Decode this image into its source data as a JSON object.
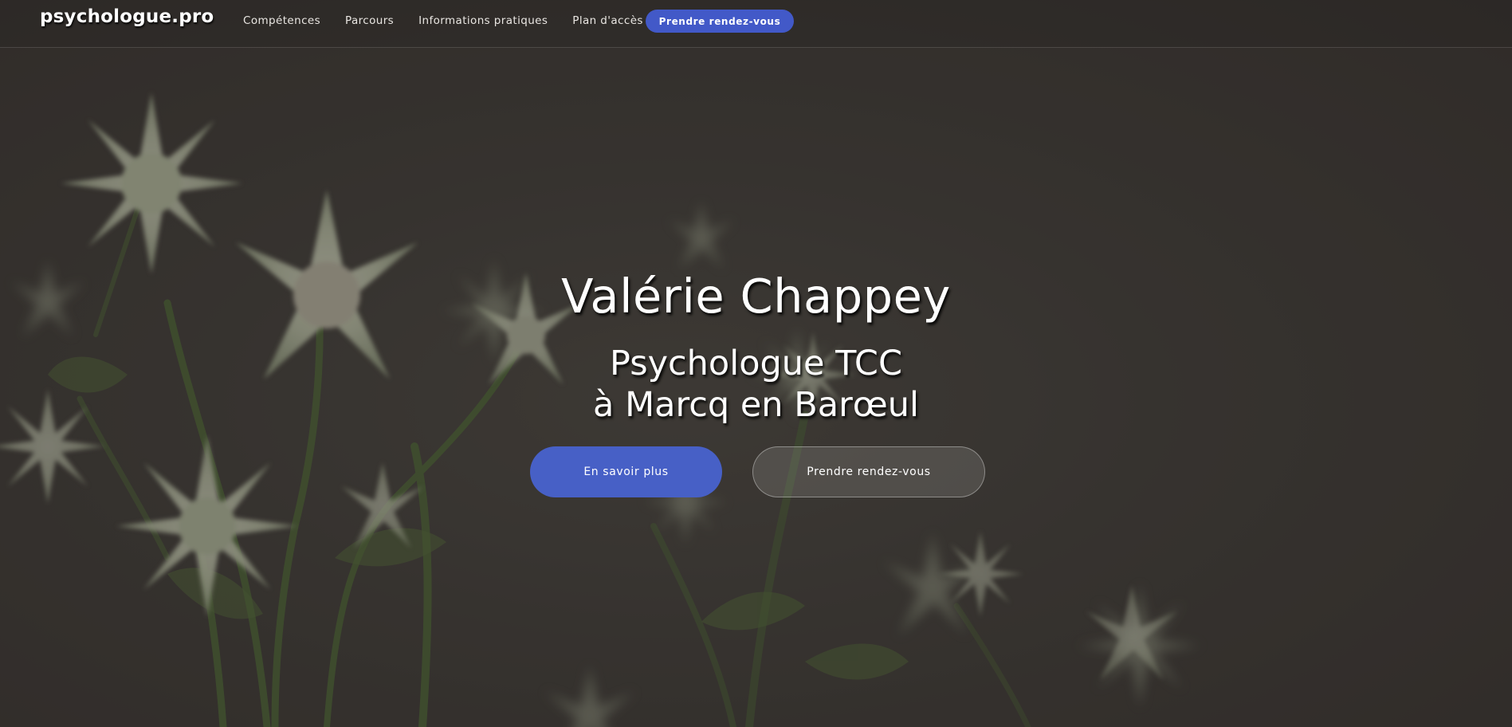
{
  "navbar": {
    "brand": "psychologue.pro",
    "links": [
      {
        "label": "Compétences"
      },
      {
        "label": "Parcours"
      },
      {
        "label": "Informations pratiques"
      },
      {
        "label": "Plan d'accès"
      }
    ],
    "cta_label": "Prendre rendez-vous"
  },
  "hero": {
    "title": "Valérie Chappey",
    "subtitle_line1": "Psychologue TCC",
    "subtitle_line2": "à Marcq en Barœul",
    "primary_button": "En savoir plus",
    "secondary_button": "Prendre rendez-vous",
    "background_image": "astrantia-flowers-photo"
  },
  "colors": {
    "accent": "#4760c6",
    "nav_cta": "#4259c8",
    "text": "#ffffff"
  }
}
